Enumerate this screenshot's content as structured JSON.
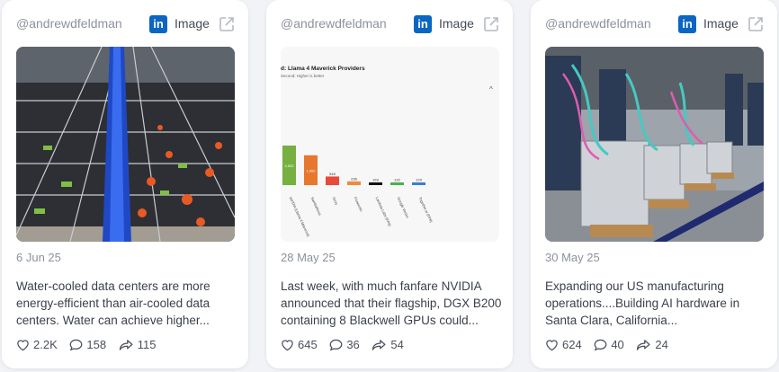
{
  "colors": {
    "linkedin": "#0a66c2",
    "muted": "#8c929c",
    "text": "#3b414a"
  },
  "posts": [
    {
      "handle": "@andrewdfeldman",
      "platform_icon": "linkedin-icon",
      "media_type": "Image",
      "date": "6 Jun 25",
      "text_lines": [
        "Water-cooled data centers are more",
        "energy-efficient than air-cooled data",
        "centers. Water can achieve higher..."
      ],
      "likes": "2.2K",
      "comments": "158",
      "reposts": "115"
    },
    {
      "handle": "@andrewdfeldman",
      "platform_icon": "linkedin-icon",
      "media_type": "Image",
      "date": "28 May 25",
      "text_lines": [
        "Last week, with much fanfare NVIDIA",
        "announced that their flagship, DGX B200",
        "containing 8 Blackwell GPUs could..."
      ],
      "likes": "645",
      "comments": "36",
      "reposts": "54",
      "image_chart": {
        "title": "d: Llama 4 Maverick Providers",
        "subtitle": "Second; Higher is better",
        "bars": [
          {
            "label": "2,522",
            "category": "NVIDIA (Llama 4 Maverick)",
            "value": 2522,
            "color": "#76b041"
          },
          {
            "label": "1,902",
            "category": "SambaNova",
            "value": 1902,
            "color": "#e8772e"
          },
          {
            "label": "549",
            "category": "Groq",
            "value": 549,
            "color": "#e8493a"
          },
          {
            "label": "236",
            "category": "Fireworks",
            "value": 236,
            "color": "#f08a3c"
          },
          {
            "label": "163",
            "category": "Lambda Labs (FP8)",
            "value": 163,
            "color": "#111111"
          },
          {
            "label": "132",
            "category": "Google Vertex",
            "value": 132,
            "color": "#4caf50"
          },
          {
            "label": "129",
            "category": "Together.ai (FP8)",
            "value": 129,
            "color": "#3b7bd6"
          }
        ]
      }
    },
    {
      "handle": "@andrewdfeldman",
      "platform_icon": "linkedin-icon",
      "media_type": "Image",
      "date": "30 May 25",
      "text_lines": [
        "Expanding our US manufacturing",
        "operations....Building AI hardware in",
        "Santa Clara, California..."
      ],
      "likes": "624",
      "comments": "40",
      "reposts": "24"
    }
  ]
}
